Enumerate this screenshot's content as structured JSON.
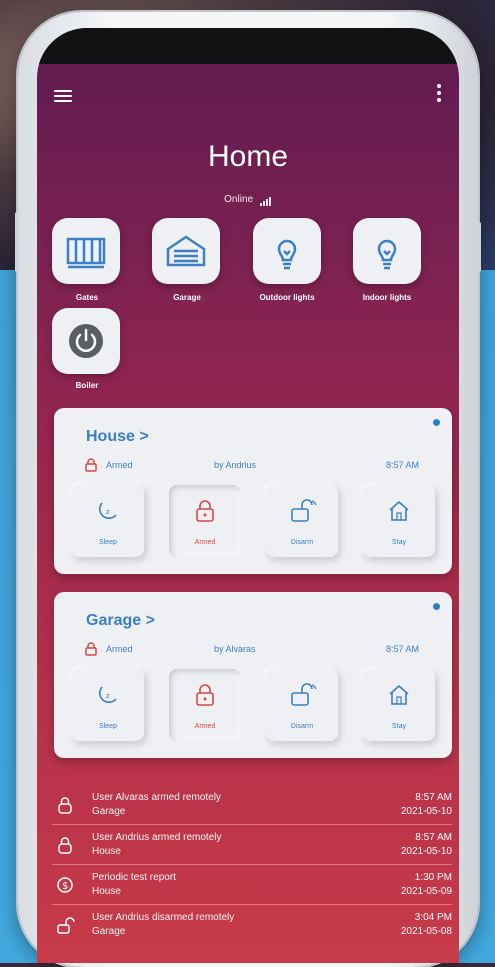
{
  "header": {
    "title": "Home",
    "status": "Online",
    "menu_icon": "hamburger-menu-icon",
    "more_icon": "more-vertical-icon"
  },
  "quick_actions": [
    {
      "label": "Gates",
      "icon": "gate-icon"
    },
    {
      "label": "Garage",
      "icon": "garage-door-icon"
    },
    {
      "label": "Outdoor lights",
      "icon": "lightbulb-icon"
    },
    {
      "label": "Indoor lights",
      "icon": "lightbulb-icon"
    },
    {
      "label": "Boiler",
      "icon": "power-icon"
    }
  ],
  "areas": [
    {
      "name": "House >",
      "state": "Armed",
      "by": "by Andrius",
      "time": "8:57 AM",
      "modes": [
        "Sleep",
        "Armed",
        "Disarm",
        "Stay"
      ],
      "active_mode": "Armed"
    },
    {
      "name": "Garage >",
      "state": "Armed",
      "by": "by Alvaras",
      "time": "8:57 AM",
      "modes": [
        "Sleep",
        "Armed",
        "Disarm",
        "Stay"
      ],
      "active_mode": "Armed"
    }
  ],
  "events": [
    {
      "title": "User Alvaras armed remotely",
      "area": "Garage",
      "time": "8:57 AM",
      "date": "2021-05-10",
      "icon": "lock-icon"
    },
    {
      "title": "User Andrius armed remotely",
      "area": "House",
      "time": "8:57 AM",
      "date": "2021-05-10",
      "icon": "lock-icon"
    },
    {
      "title": "Periodic test report",
      "area": "House",
      "time": "1:30 PM",
      "date": "2021-05-09",
      "icon": "report-icon"
    },
    {
      "title": "User Andrius disarmed remotely",
      "area": "Garage",
      "time": "3:04 PM",
      "date": "2021-05-08",
      "icon": "unlock-icon"
    }
  ],
  "colors": {
    "accent_blue": "#3b7fc4",
    "armed_red": "#d64848",
    "card_bg": "#eef0f4"
  }
}
